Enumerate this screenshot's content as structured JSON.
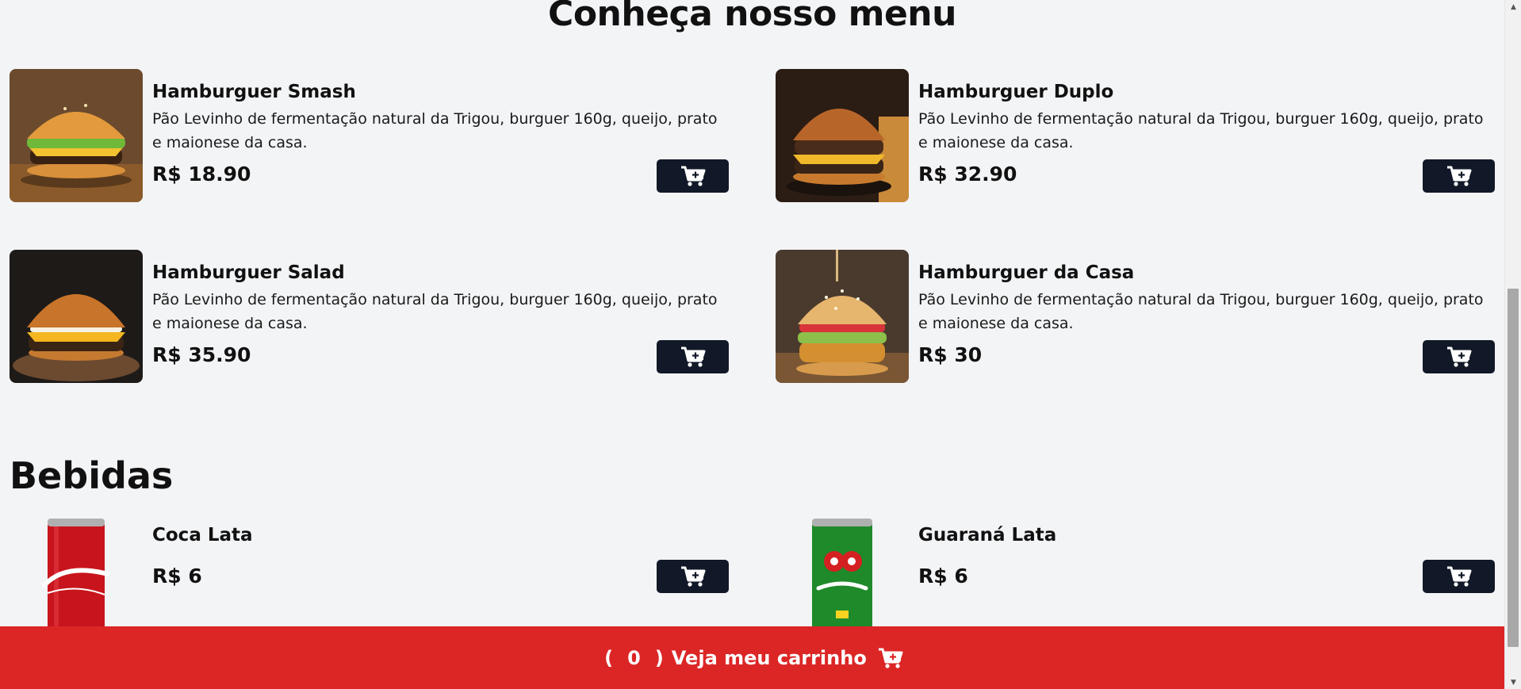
{
  "menu": {
    "title": "Conheça nosso menu",
    "items": [
      {
        "name": "Hamburguer Smash",
        "description": "Pão Levinho de fermentação natural da Trigou, burguer 160g, queijo, prato e maionese da casa.",
        "price": "R$ 18.90"
      },
      {
        "name": "Hamburguer Duplo",
        "description": "Pão Levinho de fermentação natural da Trigou, burguer 160g, queijo, prato e maionese da casa.",
        "price": "R$ 32.90"
      },
      {
        "name": "Hamburguer Salad",
        "description": "Pão Levinho de fermentação natural da Trigou, burguer 160g, queijo, prato e maionese da casa.",
        "price": "R$ 35.90"
      },
      {
        "name": "Hamburguer da Casa",
        "description": "Pão Levinho de fermentação natural da Trigou, burguer 160g, queijo, prato e maionese da casa.",
        "price": "R$ 30"
      }
    ]
  },
  "drinks": {
    "title": "Bebidas",
    "items": [
      {
        "name": "Coca Lata",
        "price": "R$ 6"
      },
      {
        "name": "Guaraná Lata",
        "price": "R$ 6"
      }
    ]
  },
  "cart": {
    "open_paren": "(",
    "count": "0",
    "close_paren": ")",
    "label": "Veja meu carrinho",
    "icon": "cart-plus-icon"
  },
  "colors": {
    "background": "#f3f4f6",
    "button": "#111827",
    "cart_bar": "#dc2626"
  }
}
